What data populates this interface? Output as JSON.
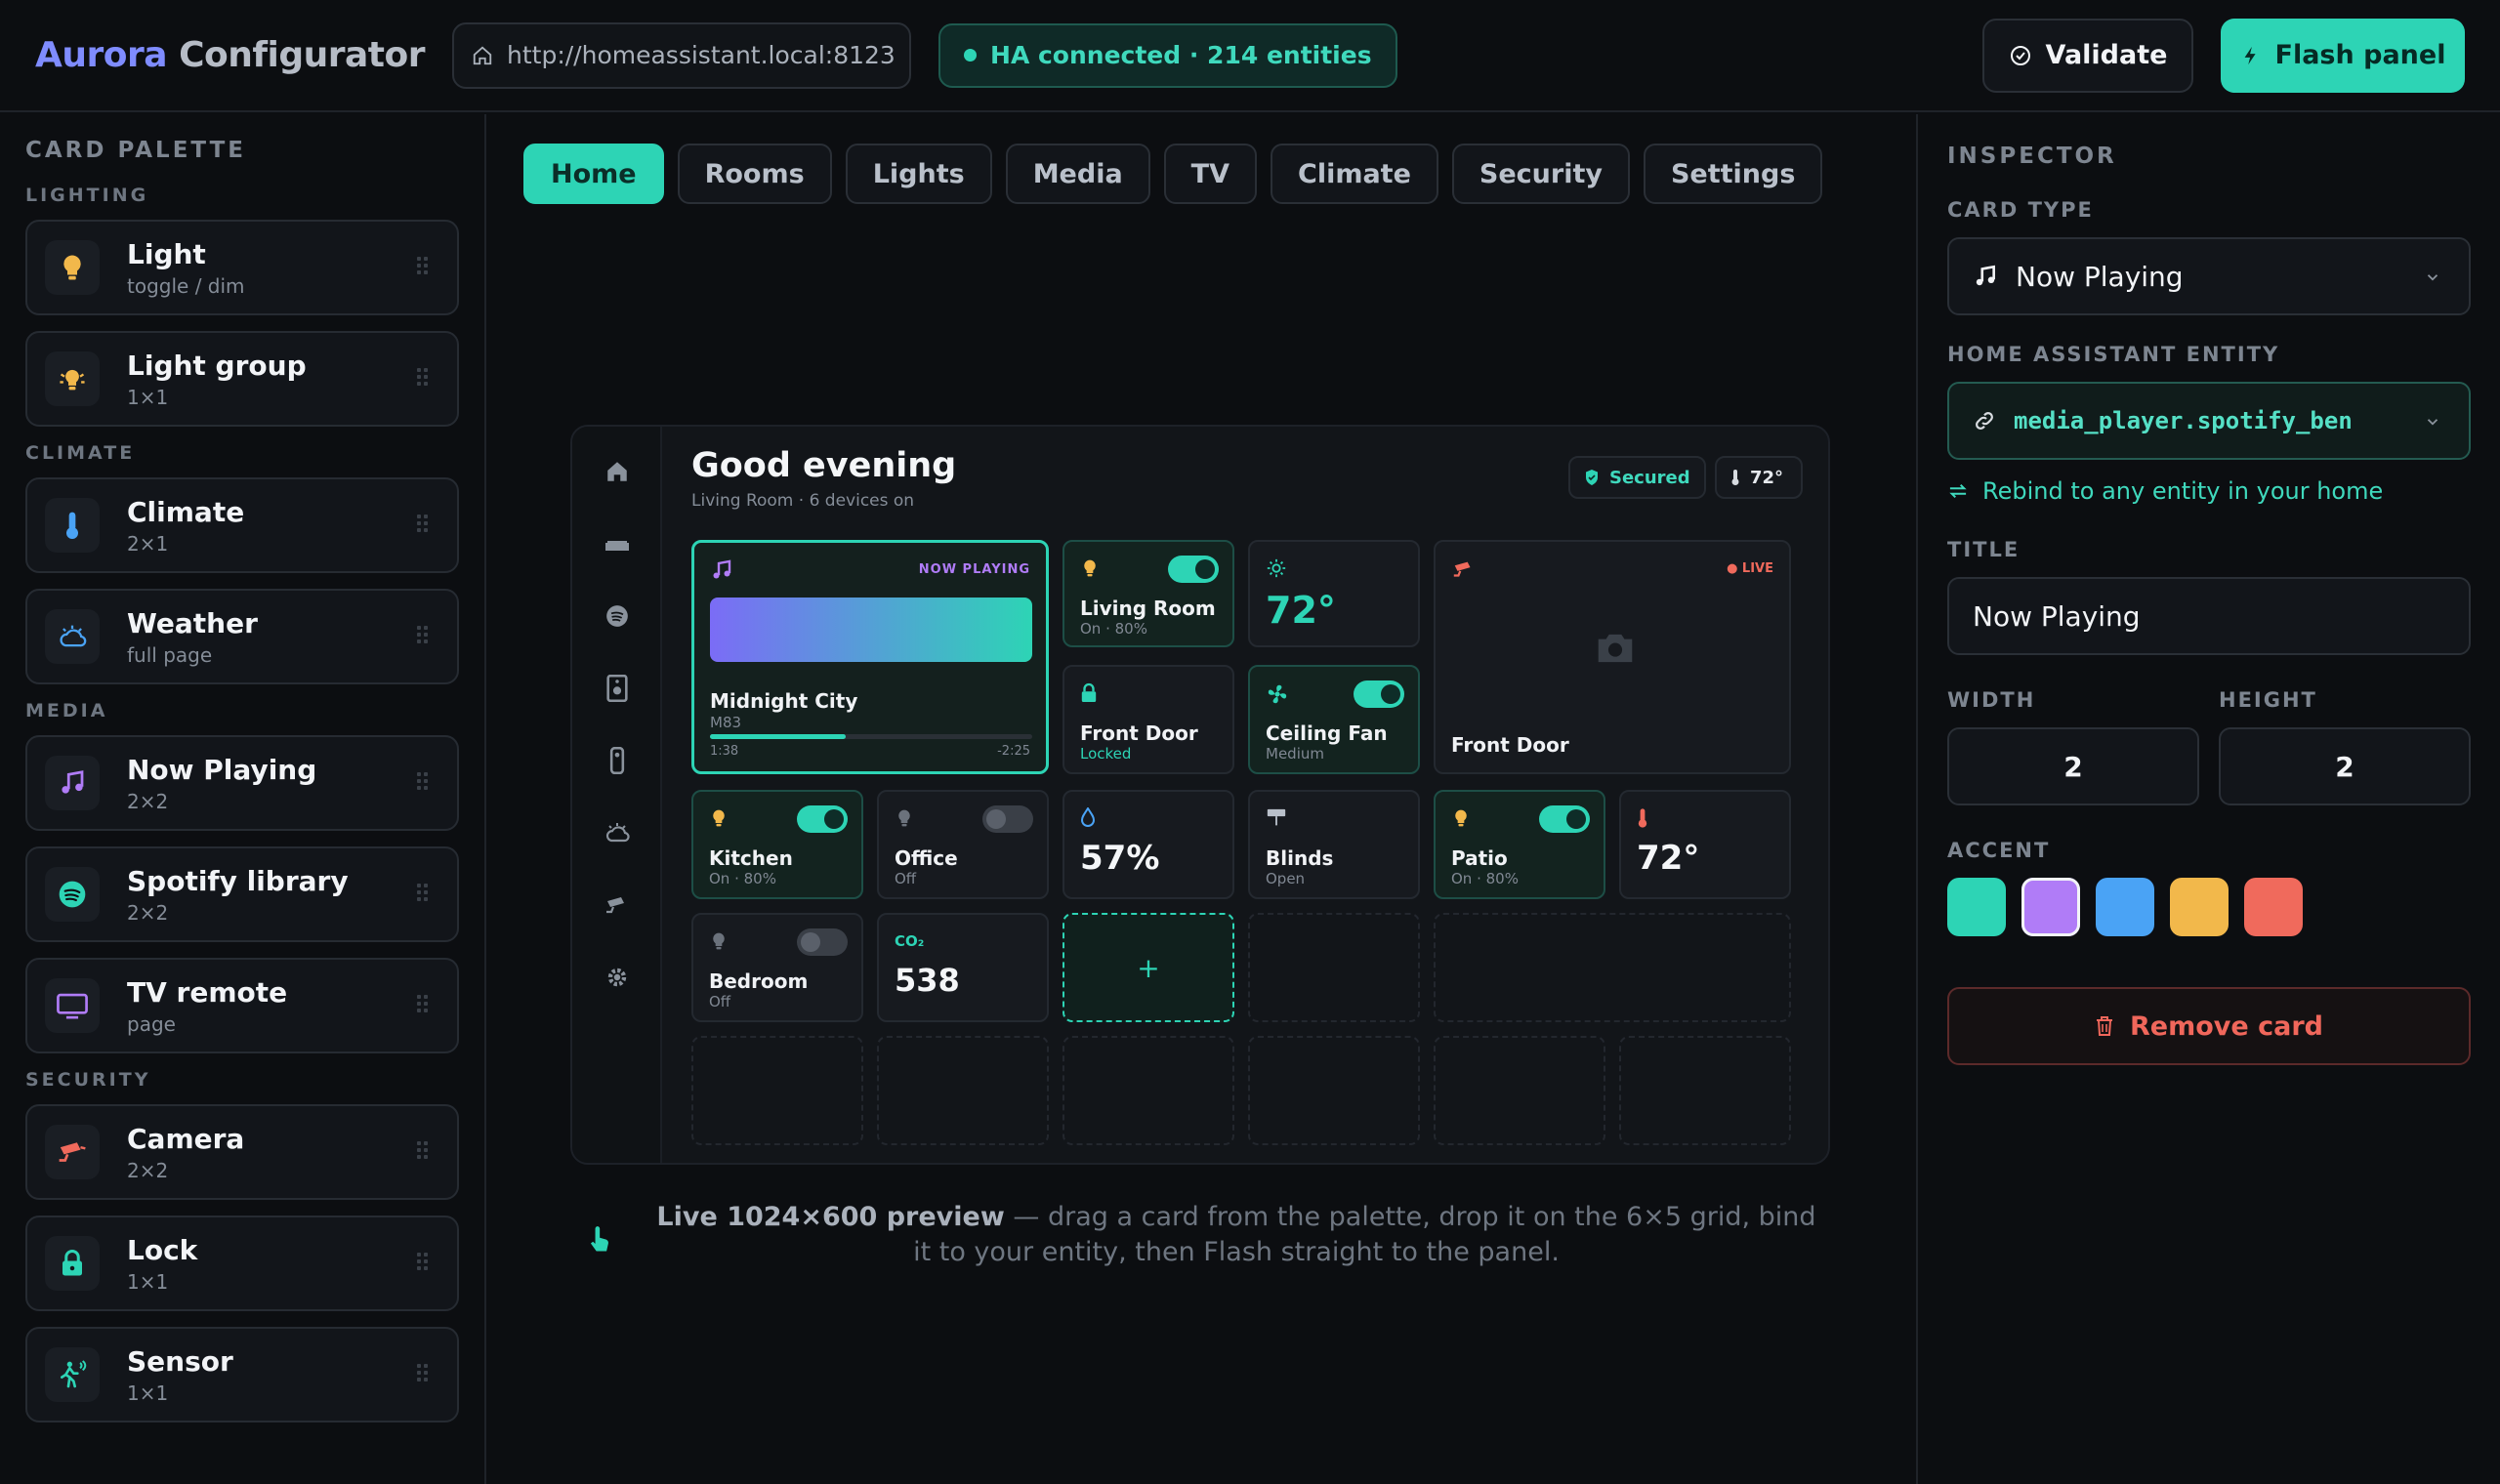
{
  "app": {
    "brand_a": "Aurora",
    "brand_b": "Configurator"
  },
  "topbar": {
    "url": "http://homeassistant.local:8123",
    "status": "HA connected · 214 entities",
    "validate_label": "Validate",
    "flash_label": "Flash panel"
  },
  "palette": {
    "heading": "CARD PALETTE",
    "categories": [
      {
        "label": "LIGHTING",
        "items": [
          {
            "name": "Light",
            "sub": "toggle / dim",
            "icon": "bulb-icon"
          },
          {
            "name": "Light group",
            "sub": "1×1",
            "icon": "light-group-icon"
          }
        ]
      },
      {
        "label": "CLIMATE",
        "items": [
          {
            "name": "Climate",
            "sub": "2×1",
            "icon": "thermometer-icon"
          },
          {
            "name": "Weather",
            "sub": "full page",
            "icon": "weather-icon"
          }
        ]
      },
      {
        "label": "MEDIA",
        "items": [
          {
            "name": "Now Playing",
            "sub": "2×2",
            "icon": "music-note-icon"
          },
          {
            "name": "Spotify library",
            "sub": "2×2",
            "icon": "spotify-icon"
          },
          {
            "name": "TV remote",
            "sub": "page",
            "icon": "tv-icon"
          }
        ]
      },
      {
        "label": "SECURITY",
        "items": [
          {
            "name": "Camera",
            "sub": "2×2",
            "icon": "camera-icon"
          },
          {
            "name": "Lock",
            "sub": "1×1",
            "icon": "lock-icon"
          },
          {
            "name": "Sensor",
            "sub": "1×1",
            "icon": "motion-sensor-icon"
          }
        ]
      }
    ]
  },
  "tabs": [
    {
      "label": "Home",
      "active": true
    },
    {
      "label": "Rooms"
    },
    {
      "label": "Lights"
    },
    {
      "label": "Media"
    },
    {
      "label": "TV"
    },
    {
      "label": "Climate"
    },
    {
      "label": "Security"
    },
    {
      "label": "Settings"
    }
  ],
  "preview": {
    "greeting": "Good evening",
    "subtitle": "Living Room · 6 devices on",
    "secured": "Secured",
    "temp_pill": "72°",
    "now_playing": {
      "badge": "NOW PLAYING",
      "track": "Midnight City",
      "artist": "M83",
      "elapsed": "1:38",
      "remaining": "-2:25",
      "progress": 0.42
    },
    "living_room": {
      "name": "Living Room",
      "state": "On · 80%"
    },
    "climate_temp": "72°",
    "camera": {
      "badge": "● LIVE",
      "name": "Front Door"
    },
    "front_door": {
      "name": "Front Door",
      "state": "Locked"
    },
    "ceiling_fan": {
      "name": "Ceiling Fan",
      "state": "Medium"
    },
    "kitchen": {
      "name": "Kitchen",
      "state": "On · 80%"
    },
    "office": {
      "name": "Office",
      "state": "Off"
    },
    "humidity": {
      "value": "57%"
    },
    "blinds": {
      "name": "Blinds",
      "state": "Open"
    },
    "patio": {
      "name": "Patio",
      "state": "On · 80%"
    },
    "patio_temp": {
      "value": "72°"
    },
    "bedroom": {
      "name": "Bedroom",
      "state": "Off"
    },
    "co2": {
      "label": "CO₂",
      "value": "538"
    },
    "add": "+"
  },
  "hint": {
    "bold": "Live 1024×600 preview",
    "rest": " — drag a card from the palette, drop it on the 6×5 grid, bind it to your entity, then Flash straight to the panel."
  },
  "inspector": {
    "heading": "INSPECTOR",
    "card_type_label": "CARD TYPE",
    "card_type": "Now Playing",
    "entity_label": "HOME ASSISTANT ENTITY",
    "entity": "media_player.spotify_ben",
    "rebind": "Rebind to any entity in your home",
    "title_label": "TITLE",
    "title_value": "Now Playing",
    "width_label": "WIDTH",
    "width_value": "2",
    "height_label": "HEIGHT",
    "height_value": "2",
    "accent_label": "ACCENT",
    "accents": [
      "#2dd4b5",
      "#b07cf7",
      "#4aa3f5",
      "#f2b84b",
      "#f06a5c"
    ],
    "selected_accent": 1,
    "remove_label": "Remove card"
  },
  "colors": {
    "accent": "#2dd4b5",
    "background": "#0c0e11",
    "danger": "#f06a5c"
  }
}
